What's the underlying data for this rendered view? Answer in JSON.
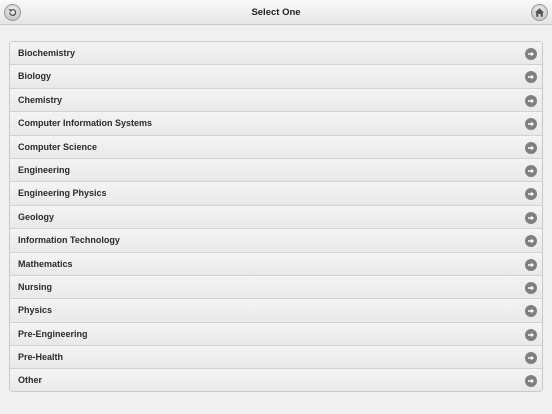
{
  "header": {
    "title": "Select One",
    "back_icon": "back-arrow-icon",
    "home_icon": "home-icon"
  },
  "list": {
    "items": [
      {
        "label": "Biochemistry"
      },
      {
        "label": "Biology"
      },
      {
        "label": "Chemistry"
      },
      {
        "label": "Computer Information Systems"
      },
      {
        "label": "Computer Science"
      },
      {
        "label": "Engineering"
      },
      {
        "label": "Engineering Physics"
      },
      {
        "label": "Geology"
      },
      {
        "label": "Information Technology"
      },
      {
        "label": "Mathematics"
      },
      {
        "label": "Nursing"
      },
      {
        "label": "Physics"
      },
      {
        "label": "Pre-Engineering"
      },
      {
        "label": "Pre-Health"
      },
      {
        "label": "Other"
      }
    ]
  },
  "colors": {
    "background": "#f0f0f0",
    "arrow": "#7f7f7f",
    "text": "#2a2a2a"
  }
}
